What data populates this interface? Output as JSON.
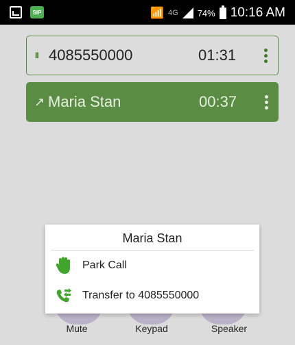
{
  "status_bar": {
    "app_badge": "SIP",
    "network": "4G",
    "battery": "74%",
    "time": "10:16 AM"
  },
  "calls": [
    {
      "status": "on-hold",
      "status_glyph": "II",
      "name": "4085550000",
      "timer": "01:31"
    },
    {
      "status": "active",
      "status_glyph": "↗",
      "name": "Maria Stan",
      "timer": "00:37"
    }
  ],
  "dialog": {
    "title": "Maria Stan",
    "items": [
      {
        "icon": "hand-icon",
        "label": "Park Call"
      },
      {
        "icon": "transfer-call-icon",
        "label": "Transfer to 4085550000"
      }
    ]
  },
  "controls": [
    {
      "label": "Mute"
    },
    {
      "label": "Keypad"
    },
    {
      "label": "Speaker"
    }
  ],
  "colors": {
    "accent": "#5a8c43",
    "background": "#dcdcdc"
  }
}
